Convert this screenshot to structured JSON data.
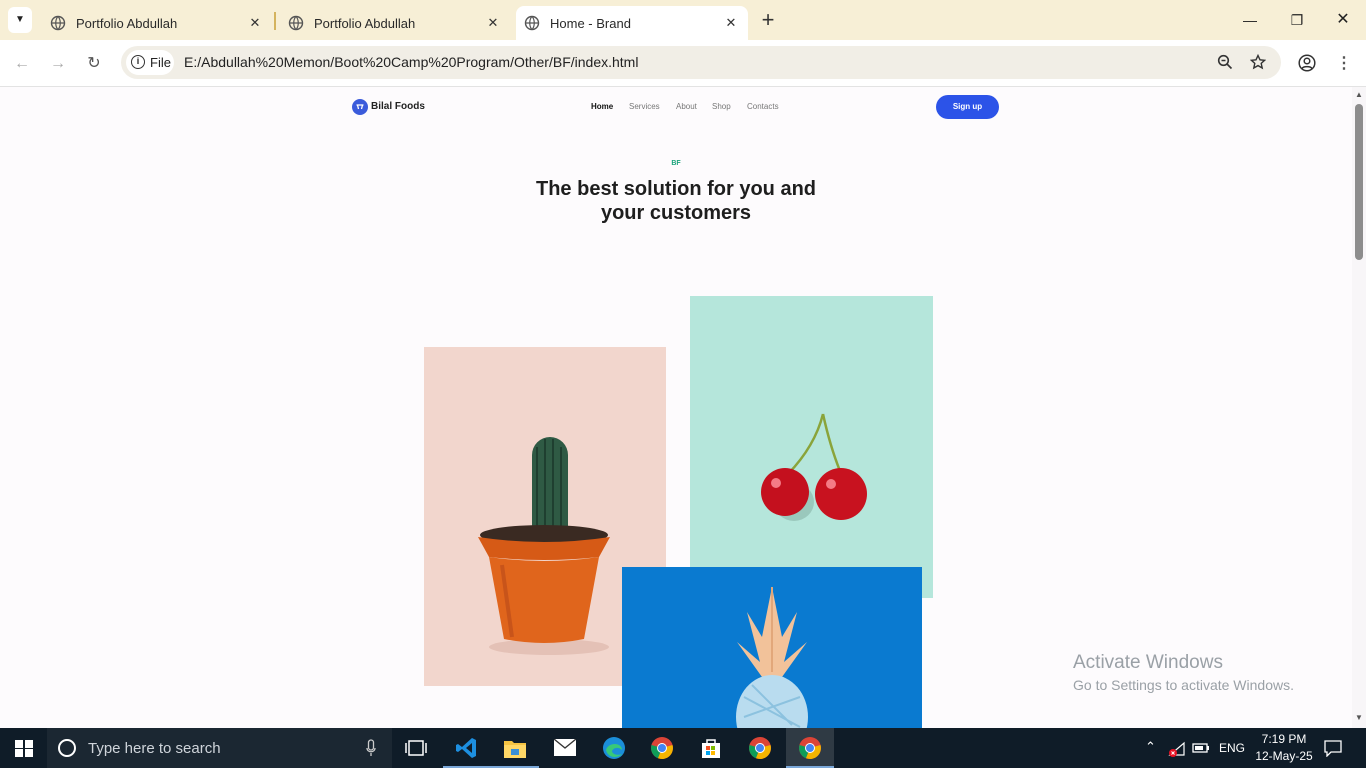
{
  "browser": {
    "tabs": [
      {
        "title": "Portfolio Abdullah",
        "active": false
      },
      {
        "title": "Portfolio Abdullah",
        "active": false
      },
      {
        "title": "Home - Brand",
        "active": true
      }
    ],
    "new_tab_label": "+",
    "address": {
      "scheme_chip": "File",
      "url": "E:/Abdullah%20Memon/Boot%20Camp%20Program/Other/BF/index.html"
    }
  },
  "site": {
    "brand": "Bilal Foods",
    "nav": [
      "Home",
      "Services",
      "About",
      "Shop",
      "Contacts"
    ],
    "signup_label": "Sign up",
    "eyebrow": "BF",
    "headline_line1": "The best solution for you and",
    "headline_line2": "your customers",
    "images": [
      "cactus-photo",
      "cherry-photo",
      "pineapple-photo"
    ]
  },
  "watermark": {
    "title": "Activate Windows",
    "subtitle": "Go to Settings to activate Windows."
  },
  "taskbar": {
    "search_placeholder": "Type here to search",
    "language": "ENG",
    "time": "7:19 PM",
    "date": "12-May-25"
  },
  "colors": {
    "accent": "#2c53e8",
    "eyebrow": "#1aa37a",
    "tabstrip": "#f7efd6"
  }
}
